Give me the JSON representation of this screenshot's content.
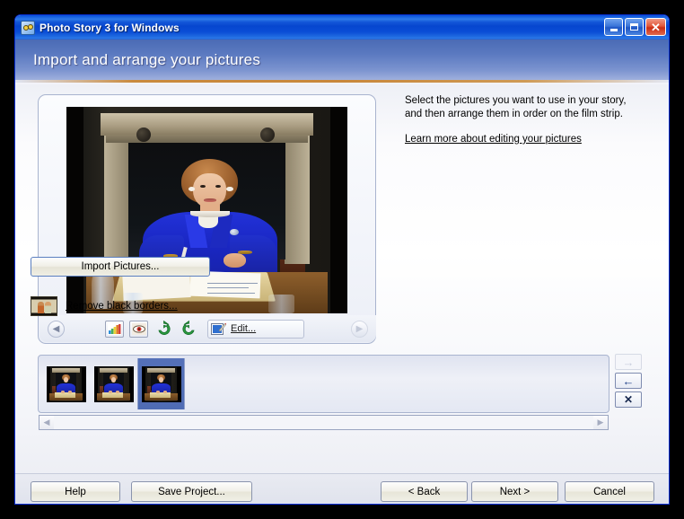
{
  "window": {
    "title": "Photo Story 3 for Windows",
    "app_icon": "photo-story-icon",
    "caption": {
      "minimize": "minimize-icon",
      "maximize": "maximize-icon",
      "close": "close-icon",
      "close_glyph": "✕"
    }
  },
  "banner": {
    "title": "Import and arrange your pictures"
  },
  "main": {
    "instructions": "Select the pictures you want to use in your story, and then arrange them in order on the film strip.",
    "learn_more_link": "Learn more about editing your pictures",
    "import_button": "Import Pictures...",
    "remove_borders_link": "Remove black borders...",
    "remove_borders_icon": "people-photo-icon"
  },
  "preview_toolbar": {
    "prev_icon": "chevron-left-icon",
    "next_icon": "chevron-right-icon",
    "prev_glyph": "◀",
    "next_glyph": "▶",
    "tools": [
      {
        "name": "color-levels-icon",
        "title": "Correct color levels"
      },
      {
        "name": "red-eye-icon",
        "title": "Remove red eye"
      },
      {
        "name": "rotate-left-icon",
        "title": "Rotate left"
      },
      {
        "name": "rotate-right-icon",
        "title": "Rotate right"
      }
    ],
    "edit_button": "Edit...",
    "edit_icon": "edit-pencil-icon"
  },
  "filmstrip": {
    "thumbnails": [
      {
        "name": "thumbnail-1",
        "selected": false
      },
      {
        "name": "thumbnail-2",
        "selected": false
      },
      {
        "name": "thumbnail-3",
        "selected": true
      }
    ],
    "scroll_left_glyph": "◀",
    "scroll_right_glyph": "▶",
    "side_buttons": [
      {
        "name": "move-right-button",
        "glyph": "→",
        "enabled": false
      },
      {
        "name": "move-left-button",
        "glyph": "←",
        "enabled": true
      },
      {
        "name": "delete-button",
        "glyph": "✕",
        "enabled": true
      }
    ]
  },
  "footer": {
    "help": "Help",
    "save_project": "Save Project...",
    "back": "< Back",
    "next": "Next >",
    "cancel": "Cancel"
  },
  "colors": {
    "titlebar_blue": "#0a50d2",
    "banner_blue": "#4a6bb5",
    "banner_accent": "#c8873a",
    "selection_blue": "#5470b8",
    "window_face": "#ece9d8"
  }
}
